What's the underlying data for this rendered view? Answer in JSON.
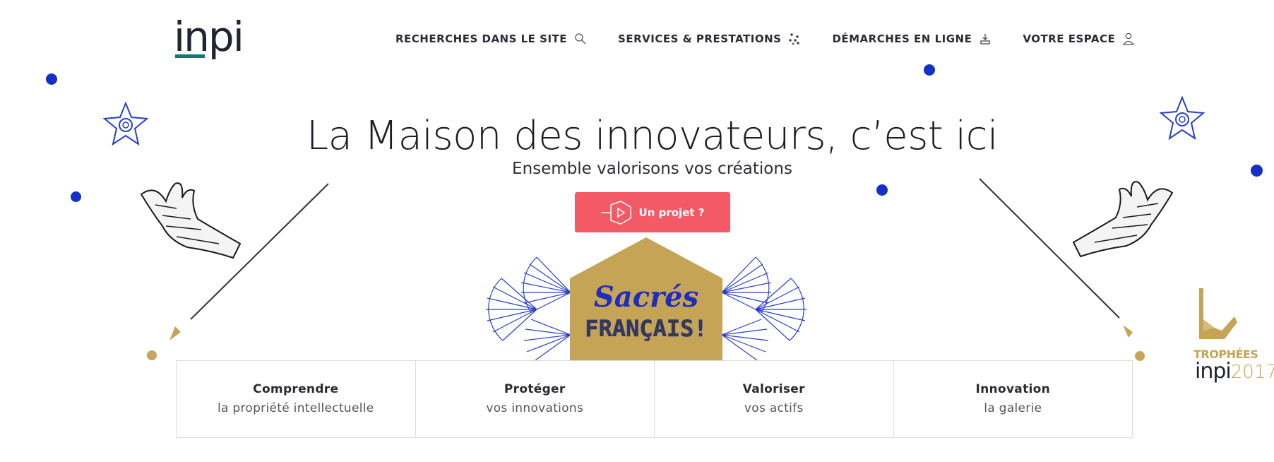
{
  "logo": {
    "text": "inpi",
    "accent": "#0d7a78"
  },
  "nav": [
    {
      "label": "RECHERCHES DANS LE SITE",
      "icon": "search-icon"
    },
    {
      "label": "SERVICES & PRESTATIONS",
      "icon": "dots-grid-icon"
    },
    {
      "label": "DÉMARCHES EN LIGNE",
      "icon": "upload-tray-icon"
    },
    {
      "label": "VOTRE ESPACE",
      "icon": "user-icon"
    }
  ],
  "hero": {
    "title": "La Maison des innovateurs, c’est ici",
    "subtitle": "Ensemble valorisons vos créations",
    "cta_label": "Un projet ?"
  },
  "banner": {
    "line1": "Sacrés",
    "line2": "FRANÇAIS!"
  },
  "cards": [
    {
      "title": "Comprendre",
      "subtitle": "la propriété intellectuelle"
    },
    {
      "title": "Protéger",
      "subtitle": "vos innovations"
    },
    {
      "title": "Valoriser",
      "subtitle": "vos actifs"
    },
    {
      "title": "Innovation",
      "subtitle": "la galerie"
    }
  ],
  "trophees": {
    "label": "TROPHÉES",
    "brand": "inpi",
    "year": "2017"
  },
  "colors": {
    "accent_red": "#f35a65",
    "blue": "#1330c9",
    "gold": "#c5a555",
    "teal": "#0d7a78"
  }
}
